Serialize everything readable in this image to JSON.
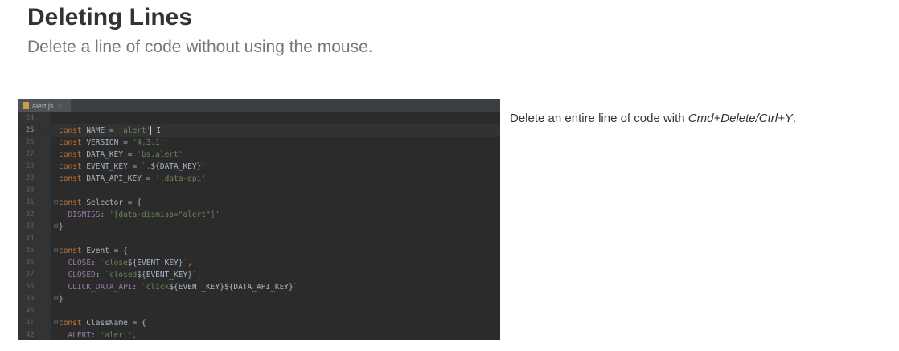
{
  "header": {
    "title": "Deleting Lines",
    "subtitle": "Delete a line of code without using the mouse."
  },
  "editor": {
    "tab": {
      "file_name": "alert.js",
      "close_glyph": "×"
    },
    "lines": [
      {
        "num": "24",
        "tokens": []
      },
      {
        "num": "25",
        "current": true,
        "caret": true,
        "tokens": [
          {
            "t": "kw",
            "v": "const "
          },
          {
            "t": "plain",
            "v": "NAME = "
          },
          {
            "t": "str",
            "v": "'alert'"
          }
        ]
      },
      {
        "num": "26",
        "tokens": [
          {
            "t": "kw",
            "v": "const "
          },
          {
            "t": "plain",
            "v": "VERSION = "
          },
          {
            "t": "str",
            "v": "'4.3.1'"
          }
        ]
      },
      {
        "num": "27",
        "tokens": [
          {
            "t": "kw",
            "v": "const "
          },
          {
            "t": "plain",
            "v": "DATA_KEY = "
          },
          {
            "t": "str",
            "v": "'bs.alert'"
          }
        ]
      },
      {
        "num": "28",
        "tokens": [
          {
            "t": "kw",
            "v": "const "
          },
          {
            "t": "plain",
            "v": "EVENT_KEY = "
          },
          {
            "t": "str",
            "v": "`."
          },
          {
            "t": "plain",
            "v": "${DATA_KEY}"
          },
          {
            "t": "str",
            "v": "`"
          }
        ]
      },
      {
        "num": "29",
        "tokens": [
          {
            "t": "kw",
            "v": "const "
          },
          {
            "t": "plain",
            "v": "DATA_API_KEY = "
          },
          {
            "t": "str",
            "v": "'.data-api'"
          }
        ]
      },
      {
        "num": "30",
        "tokens": []
      },
      {
        "num": "31",
        "fold": "⊟",
        "tokens": [
          {
            "t": "kw",
            "v": "const "
          },
          {
            "t": "plain",
            "v": "Selector = {"
          }
        ]
      },
      {
        "num": "32",
        "tokens": [
          {
            "t": "plain",
            "v": "  "
          },
          {
            "t": "prop",
            "v": "DISMISS"
          },
          {
            "t": "plain",
            "v": ": "
          },
          {
            "t": "str",
            "v": "'[data-dismiss=\"alert\"]'"
          }
        ]
      },
      {
        "num": "33",
        "fold": "⊟",
        "tokens": [
          {
            "t": "plain",
            "v": "}"
          }
        ]
      },
      {
        "num": "34",
        "tokens": []
      },
      {
        "num": "35",
        "fold": "⊟",
        "tokens": [
          {
            "t": "kw",
            "v": "const "
          },
          {
            "t": "plain",
            "v": "Event = {"
          }
        ]
      },
      {
        "num": "36",
        "tokens": [
          {
            "t": "plain",
            "v": "  "
          },
          {
            "t": "prop",
            "v": "CLOSE"
          },
          {
            "t": "plain",
            "v": ": "
          },
          {
            "t": "str",
            "v": "`close"
          },
          {
            "t": "plain",
            "v": "${EVENT_KEY}"
          },
          {
            "t": "str",
            "v": "`"
          },
          {
            "t": "kw",
            "v": ","
          }
        ]
      },
      {
        "num": "37",
        "tokens": [
          {
            "t": "plain",
            "v": "  "
          },
          {
            "t": "prop",
            "v": "CLOSED"
          },
          {
            "t": "plain",
            "v": ": "
          },
          {
            "t": "str",
            "v": "`closed"
          },
          {
            "t": "plain",
            "v": "${EVENT_KEY}"
          },
          {
            "t": "str",
            "v": "`"
          },
          {
            "t": "kw",
            "v": ","
          }
        ]
      },
      {
        "num": "38",
        "tokens": [
          {
            "t": "plain",
            "v": "  "
          },
          {
            "t": "prop",
            "v": "CLICK_DATA_API"
          },
          {
            "t": "plain",
            "v": ": "
          },
          {
            "t": "str",
            "v": "`click"
          },
          {
            "t": "plain",
            "v": "${EVENT_KEY}${DATA_API_KEY}"
          },
          {
            "t": "str",
            "v": "`"
          }
        ]
      },
      {
        "num": "39",
        "fold": "⊟",
        "tokens": [
          {
            "t": "plain",
            "v": "}"
          }
        ]
      },
      {
        "num": "40",
        "tokens": []
      },
      {
        "num": "41",
        "fold": "⊟",
        "tokens": [
          {
            "t": "kw",
            "v": "const "
          },
          {
            "t": "plain",
            "v": "ClassName = {"
          }
        ]
      },
      {
        "num": "42",
        "tokens": [
          {
            "t": "plain",
            "v": "  "
          },
          {
            "t": "prop",
            "v": "ALERT"
          },
          {
            "t": "plain",
            "v": ": "
          },
          {
            "t": "str",
            "v": "'alert'"
          },
          {
            "t": "kw",
            "v": ","
          }
        ]
      }
    ]
  },
  "description": {
    "text_before": "Delete an entire line of code with ",
    "shortcut": "Cmd+Delete/Ctrl+Y",
    "text_after": "."
  }
}
